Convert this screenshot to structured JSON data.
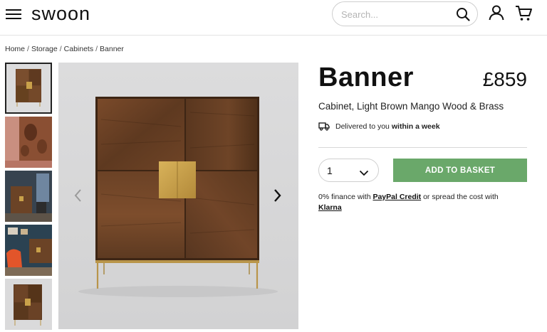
{
  "header": {
    "logo": "swoon",
    "search_placeholder": "Search..."
  },
  "breadcrumb": [
    "Home",
    "Storage",
    "Cabinets",
    "Banner"
  ],
  "product": {
    "title": "Banner",
    "price": "£859",
    "subtitle": "Cabinet, Light Brown Mango Wood & Brass",
    "delivery_text": "Delivered to you",
    "delivery_bold": "within a week",
    "quantity": "1",
    "add_button": "ADD TO BASKET"
  },
  "finance": {
    "prefix": "0% finance with",
    "paypal": "PayPal Credit",
    "middle": "or spread the cost with",
    "klarna": "Klarna"
  },
  "colors": {
    "accent_green": "#6aa86a",
    "wood": "#6b4326",
    "brass": "#c9a14a"
  },
  "icons": [
    "menu-icon",
    "search-icon",
    "account-icon",
    "basket-icon",
    "truck-icon",
    "chevron-down-icon",
    "chevron-left-icon",
    "chevron-right-icon"
  ]
}
